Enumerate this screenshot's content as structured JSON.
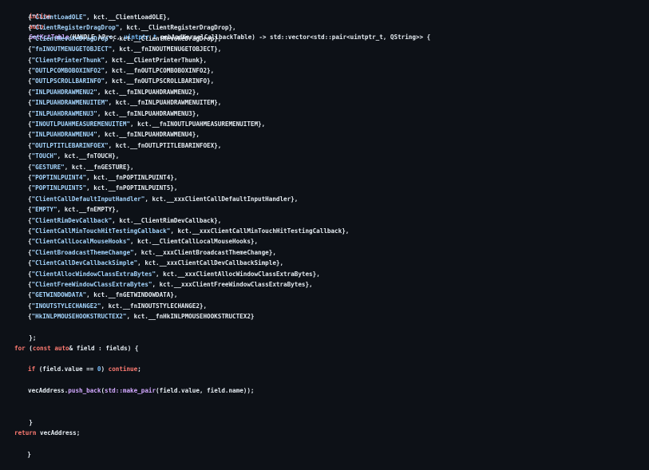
{
  "header": {
    "kw_inline": "inline",
    "kw_auto": "auto",
    "fn_name": "GetKctTable",
    "p1": "(HANDLE hProc, ",
    "ty_uintptr": "uintptr_t",
    "p2": " pebAndKernelCallbackTable) -> std::vector<std::pair<uintptr_t, QString>> {"
  },
  "entries": [
    {
      "key": "\"ClientLoadOLE\"",
      "val": ", kct.__ClientLoadOLE},"
    },
    {
      "key": "\"ClientRegisterDragDrop\"",
      "val": ", kct.__ClientRegisterDragDrop},"
    },
    {
      "key": "\"ClientRevokeDragDrop\"",
      "val": ", kct.__ClientRevokeDragDrop},"
    },
    {
      "key": "\"fnINOUTMENUGETOBJECT\"",
      "val": ", kct.__fnINOUTMENUGETOBJECT},"
    },
    {
      "key": "\"ClientPrinterThunk\"",
      "val": ", kct.__ClientPrinterThunk},"
    },
    {
      "key": "\"OUTLPCOMBOBOXINFO2\"",
      "val": ", kct.__fnOUTLPCOMBOBOXINFO2},"
    },
    {
      "key": "\"OUTLPSCROLLBARINFO\"",
      "val": ", kct.__fnOUTLPSCROLLBARINFO},"
    },
    {
      "key": "\"INLPUAHDRAWMENU2\"",
      "val": ", kct.__fnINLPUAHDRAWMENU2},"
    },
    {
      "key": "\"INLPUAHDRAWMENUITEM\"",
      "val": ", kct.__fnINLPUAHDRAWMENUITEM},"
    },
    {
      "key": "\"INLPUAHDRAWMENU3\"",
      "val": ", kct.__fnINLPUAHDRAWMENU3},"
    },
    {
      "key": "\"INOUTLPUAHMEASUREMENUITEM\"",
      "val": ", kct.__fnINOUTLPUAHMEASUREMENUITEM},"
    },
    {
      "key": "\"INLPUAHDRAWMENU4\"",
      "val": ", kct.__fnINLPUAHDRAWMENU4},"
    },
    {
      "key": "\"OUTLPTITLEBARINFOEX\"",
      "val": ", kct.__fnOUTLPTITLEBARINFOEX},"
    },
    {
      "key": "\"TOUCH\"",
      "val": ", kct.__fnTOUCH},"
    },
    {
      "key": "\"GESTURE\"",
      "val": ", kct.__fnGESTURE},"
    },
    {
      "key": "\"POPTINLPUINT4\"",
      "val": ", kct.__fnPOPTINLPUINT4},"
    },
    {
      "key": "\"POPTINLPUINT5\"",
      "val": ", kct.__fnPOPTINLPUINT5},"
    },
    {
      "key": "\"ClientCallDefaultInputHandler\"",
      "val": ", kct.__xxxClientCallDefaultInputHandler},"
    },
    {
      "key": "\"EMPTY\"",
      "val": ", kct.__fnEMPTY},"
    },
    {
      "key": "\"ClientRimDevCallback\"",
      "val": ", kct.__ClientRimDevCallback},"
    },
    {
      "key": "\"ClientCallMinTouchHitTestingCallback\"",
      "val": ", kct.__xxxClientCallMinTouchHitTestingCallback},"
    },
    {
      "key": "\"ClientCallLocalMouseHooks\"",
      "val": ", kct.__ClientCallLocalMouseHooks},"
    },
    {
      "key": "\"ClientBroadcastThemeChange\"",
      "val": ", kct.__xxxClientBroadcastThemeChange},"
    },
    {
      "key": "\"ClientCallDevCallbackSimple\"",
      "val": ", kct.__xxxClientCallDevCallbackSimple},"
    },
    {
      "key": "\"ClientAllocWindowClassExtraBytes\"",
      "val": ", kct.__xxxClientAllocWindowClassExtraBytes},"
    },
    {
      "key": "\"ClientFreeWindowClassExtraBytes\"",
      "val": ", kct.__xxxClientFreeWindowClassExtraBytes},"
    },
    {
      "key": "\"GETWINDOWDATA\"",
      "val": ", kct.__fnGETWINDOWDATA},"
    },
    {
      "key": "\"INOUTSTYLECHANGE2\"",
      "val": ", kct.__fnINOUTSTYLECHANGE2},"
    },
    {
      "key": "\"HkINLPMOUSEHOOKSTRUCTEX2\"",
      "val": ", kct.__fnHkINLPMOUSEHOOKSTRUCTEX2}"
    }
  ],
  "entry_open": "{",
  "close_init": "};",
  "for_line": {
    "kw_for": "for",
    "p1": " (",
    "kw_const": "const",
    "sp": " ",
    "kw_auto": "auto",
    "p2": "& field : fields) {"
  },
  "if_line": {
    "kw_if": "if",
    "p1": " (field.value == ",
    "num": "0",
    "p2": ") ",
    "kw_continue": "continue",
    "p3": ";"
  },
  "push_line": {
    "p1": "vecAddress.",
    "fn_push": "push_back",
    "p2": "(",
    "fn_pair": "std::make_pair",
    "p3": "(field.value, field.name));"
  },
  "close_for": "}",
  "return_line": {
    "kw_return": "return",
    "p1": " vecAddress;"
  },
  "close_fn": "}"
}
